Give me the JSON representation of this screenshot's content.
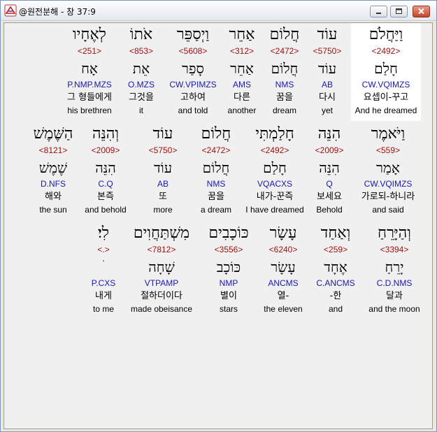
{
  "window": {
    "title": "@원전분해 - 창 37:9",
    "buttons": {
      "minimize": "minimize-icon",
      "maximize": "maximize-icon",
      "close": "close-icon"
    }
  },
  "rows": [
    {
      "words": [
        {
          "heb": "וַיַּחֲלֹם",
          "strong": "<2492>",
          "lemma": "חָלַם",
          "parse": "CW.VQIMZS",
          "kor": "요셉이-꾸고",
          "eng": "And he dreamed",
          "selected": true
        },
        {
          "heb": "עוֹד",
          "strong": "<5750>",
          "lemma": "עוֹד",
          "parse": "AB",
          "kor": "다시",
          "eng": "yet"
        },
        {
          "heb": "חֲלוֹם",
          "strong": "<2472>",
          "lemma": "חֲלוֹם",
          "parse": "NMS",
          "kor": "꿈을",
          "eng": "dream"
        },
        {
          "heb": "אַחֵר",
          "strong": "<312>",
          "lemma": "אַחֵר",
          "parse": "AMS",
          "kor": "다른",
          "eng": "another"
        },
        {
          "heb": "וַיְסַפֵּר",
          "strong": "<5608>",
          "lemma": "סָפַר",
          "parse": "CW.VPIMZS",
          "kor": "고하여",
          "eng": "and told"
        },
        {
          "heb": "אֹתוֹ",
          "strong": "<853>",
          "lemma": "אֵת",
          "parse": "O.MZS",
          "kor": "그것을",
          "eng": "it"
        },
        {
          "heb": "לְאֶחָיו",
          "strong": "<251>",
          "lemma": "אָח",
          "parse": "P.NMP.MZS",
          "kor": "그 형들에게",
          "eng": "his brethren"
        }
      ]
    },
    {
      "words": [
        {
          "heb": "וַיֹּאמֶר",
          "strong": "<559>",
          "lemma": "אָמַר",
          "parse": "CW.VQIMZS",
          "kor": "가로되-하니라",
          "eng": "and said"
        },
        {
          "heb": "הִנֵּה",
          "strong": "<2009>",
          "lemma": "הִנֵּה",
          "parse": "Q",
          "kor": "보세요",
          "eng": "Behold"
        },
        {
          "heb": "חָלַמְתִּי",
          "strong": "<2492>",
          "lemma": "חָלַם",
          "parse": "VQACXS",
          "kor": "내가-꾼즉",
          "eng": "I have dreamed"
        },
        {
          "heb": "חֲלוֹם",
          "strong": "<2472>",
          "lemma": "חֲלוֹם",
          "parse": "NMS",
          "kor": "꿈을",
          "eng": "a dream"
        },
        {
          "heb": "עוֹד",
          "strong": "<5750>",
          "lemma": "עוֹד",
          "parse": "AB",
          "kor": "또",
          "eng": "more"
        },
        {
          "heb": "וְהִנֵּה",
          "strong": "<2009>",
          "lemma": "הִנֵּה",
          "parse": "C.Q",
          "kor": "본즉",
          "eng": "and behold"
        },
        {
          "heb": "הַשֶּׁמֶשׁ",
          "strong": "<8121>",
          "lemma": "שֶׁמֶשׁ",
          "parse": "D.NFS",
          "kor": "해와",
          "eng": "the sun"
        }
      ]
    },
    {
      "words": [
        {
          "heb": "וְהַיָּרֵחַ",
          "strong": "<3394>",
          "lemma": "יָרֵחַ",
          "parse": "C.D.NMS",
          "kor": "달과",
          "eng": "and the moon"
        },
        {
          "heb": "וְאַחַד",
          "strong": "<259>",
          "lemma": "אֶחָד",
          "parse": "C.ANCMS",
          "kor": "-한",
          "eng": "and"
        },
        {
          "heb": "עָשָׂר",
          "strong": "<6240>",
          "lemma": "עָשָׂר",
          "parse": "ANCMS",
          "kor": "열-",
          "eng": "the eleven"
        },
        {
          "heb": "כּוֹכָבִים",
          "strong": "<3556>",
          "lemma": "כּוֹכָב",
          "parse": "NMP",
          "kor": "별이",
          "eng": "stars"
        },
        {
          "heb": "מִשְׁתַּחֲוִים",
          "strong": "<7812>",
          "lemma": "שָׁחָה",
          "parse": "VTPAMP",
          "kor": "절하더이다",
          "eng": "made obeisance"
        },
        {
          "heb": "לִי׃",
          "strong": "<.>",
          "lemma": "ׄ",
          "parse": "P.CXS",
          "kor": "내게",
          "eng": "to me"
        }
      ]
    }
  ]
}
